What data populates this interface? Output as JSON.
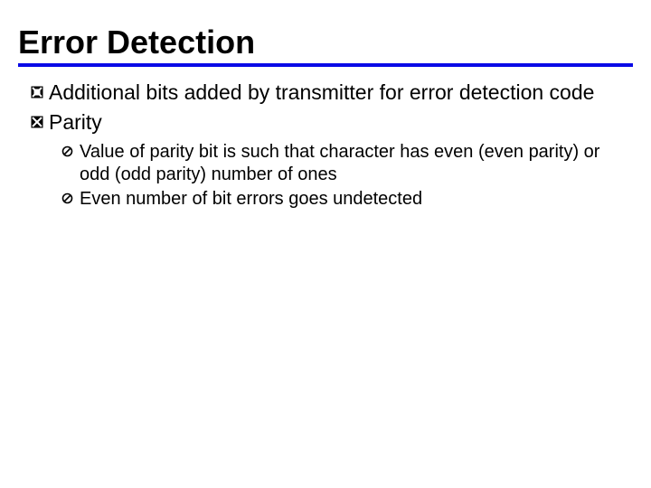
{
  "title": "Error Detection",
  "bullets": {
    "b1": "Additional bits added by transmitter for error detection code",
    "b2": "Parity",
    "sub": {
      "s1": "Value of parity bit is such that character has even (even parity) or odd (odd parity) number of ones",
      "s2": "Even number of bit errors goes undetected"
    }
  },
  "glyphs": {
    "square": "❚",
    "circle": "❍"
  }
}
